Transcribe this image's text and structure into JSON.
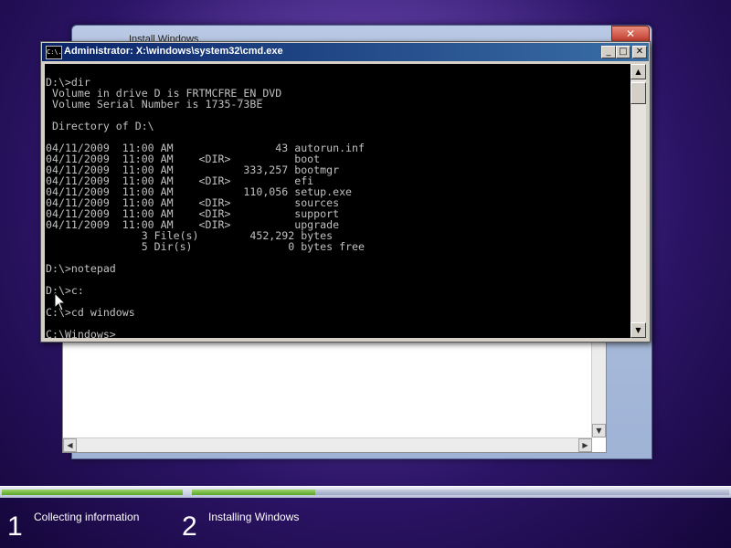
{
  "install_window": {
    "title": "Install Windows",
    "close_label": "✕"
  },
  "cmd_window": {
    "title": "Administrator: X:\\windows\\system32\\cmd.exe",
    "icon_label": "C:\\.",
    "minimize_label": "_",
    "maximize_label": "□",
    "close_label": "✕",
    "console_lines": [
      "",
      "D:\\>dir",
      " Volume in drive D is FRTMCFRE_EN_DVD",
      " Volume Serial Number is 1735-73BE",
      "",
      " Directory of D:\\",
      "",
      "04/11/2009  11:00 AM                43 autorun.inf",
      "04/11/2009  11:00 AM    <DIR>          boot",
      "04/11/2009  11:00 AM           333,257 bootmgr",
      "04/11/2009  11:00 AM    <DIR>          efi",
      "04/11/2009  11:00 AM           110,056 setup.exe",
      "04/11/2009  11:00 AM    <DIR>          sources",
      "04/11/2009  11:00 AM    <DIR>          support",
      "04/11/2009  11:00 AM    <DIR>          upgrade",
      "               3 File(s)        452,292 bytes",
      "               5 Dir(s)               0 bytes free",
      "",
      "D:\\>notepad",
      "",
      "D:\\>c:",
      "",
      "C:\\>cd windows",
      "",
      "C:\\Windows>"
    ]
  },
  "progress": {
    "step1_complete_fraction": 1.0,
    "step2_complete_fraction": 0.23
  },
  "steps": [
    {
      "number": "1",
      "label": "Collecting information"
    },
    {
      "number": "2",
      "label": "Installing Windows"
    }
  ]
}
